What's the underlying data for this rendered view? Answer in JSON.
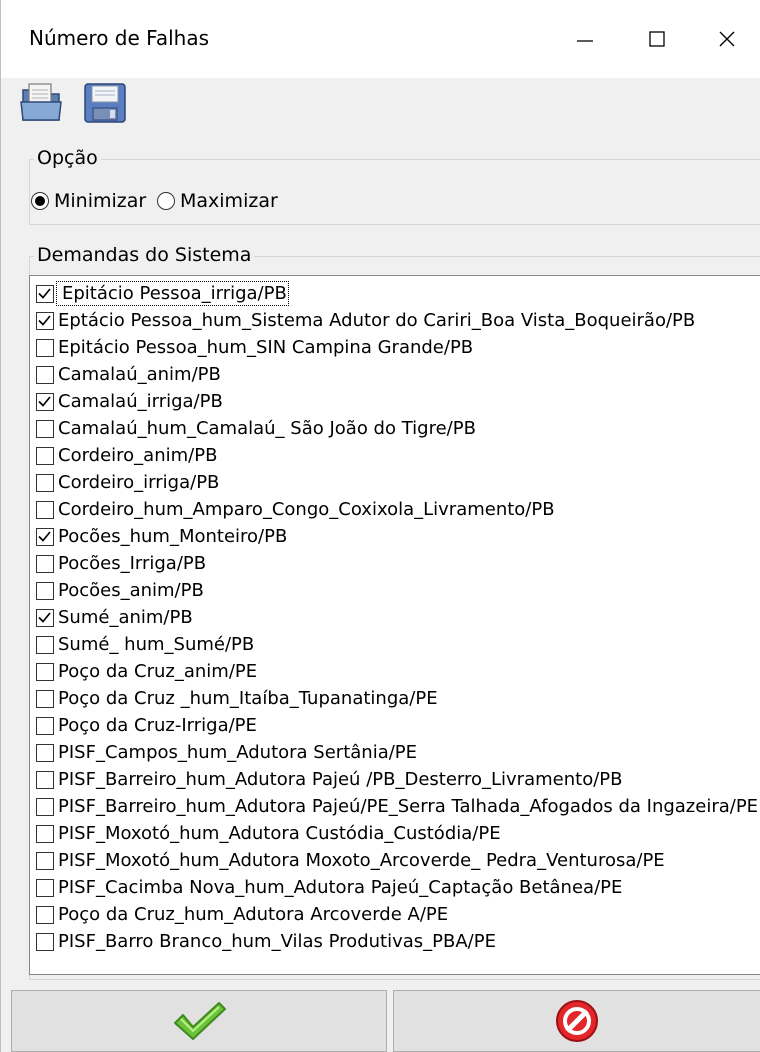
{
  "window": {
    "title": "Número de Falhas",
    "controls": {
      "minimize": "minimize-icon",
      "maximize": "maximize-icon",
      "close": "close-icon"
    }
  },
  "toolbar": {
    "open_icon": "open-file-icon",
    "save_icon": "save-disk-icon"
  },
  "opcao": {
    "label": "Opção",
    "options": [
      {
        "label": "Minimizar",
        "selected": true
      },
      {
        "label": "Maximizar",
        "selected": false
      }
    ]
  },
  "demandas": {
    "label": "Demandas do Sistema",
    "items": [
      {
        "label": "Epitácio Pessoa_irriga/PB",
        "checked": true
      },
      {
        "label": "Eptácio Pessoa_hum_Sistema Adutor do Cariri_Boa Vista_Boqueirão/PB",
        "checked": true
      },
      {
        "label": "Epitácio Pessoa_hum_SIN Campina Grande/PB",
        "checked": false
      },
      {
        "label": "Camalaú_anim/PB",
        "checked": false
      },
      {
        "label": "Camalaú_irriga/PB",
        "checked": true
      },
      {
        "label": "Camalaú_hum_Camalaú_ São João do Tigre/PB",
        "checked": false
      },
      {
        "label": "Cordeiro_anim/PB",
        "checked": false
      },
      {
        "label": "Cordeiro_irriga/PB",
        "checked": false
      },
      {
        "label": "Cordeiro_hum_Amparo_Congo_Coxixola_Livramento/PB",
        "checked": false
      },
      {
        "label": "Pocões_hum_Monteiro/PB",
        "checked": true
      },
      {
        "label": "Pocões_Irriga/PB",
        "checked": false
      },
      {
        "label": "Pocões_anim/PB",
        "checked": false
      },
      {
        "label": "Sumé_anim/PB",
        "checked": true
      },
      {
        "label": "Sumé_ hum_Sumé/PB",
        "checked": false
      },
      {
        "label": "Poço da Cruz_anim/PE",
        "checked": false
      },
      {
        "label": "Poço da Cruz _hum_Itaíba_Tupanatinga/PE",
        "checked": false
      },
      {
        "label": "Poço da Cruz-Irriga/PE",
        "checked": false
      },
      {
        "label": "PISF_Campos_hum_Adutora Sertânia/PE",
        "checked": false
      },
      {
        "label": "PISF_Barreiro_hum_Adutora Pajeú /PB_Desterro_Livramento/PB",
        "checked": false
      },
      {
        "label": "PISF_Barreiro_hum_Adutora Pajeú/PE_Serra Talhada_Afogados da Ingazeira/PE",
        "checked": false
      },
      {
        "label": "PISF_Moxotó_hum_Adutora Custódia_Custódia/PE",
        "checked": false
      },
      {
        "label": "PISF_Moxotó_hum_Adutora Moxoto_Arcoverde_ Pedra_Venturosa/PE",
        "checked": false
      },
      {
        "label": "PISF_Cacimba Nova_hum_Adutora Pajeú_Captação Betânea/PE",
        "checked": false
      },
      {
        "label": "Poço da Cruz_hum_Adutora Arcoverde A/PE",
        "checked": false
      },
      {
        "label": "PISF_Barro Branco_hum_Vilas Produtivas_PBA/PE",
        "checked": false
      }
    ]
  },
  "buttons": {
    "ok_icon": "green-checkmark-icon",
    "cancel_icon": "red-cancel-icon"
  }
}
